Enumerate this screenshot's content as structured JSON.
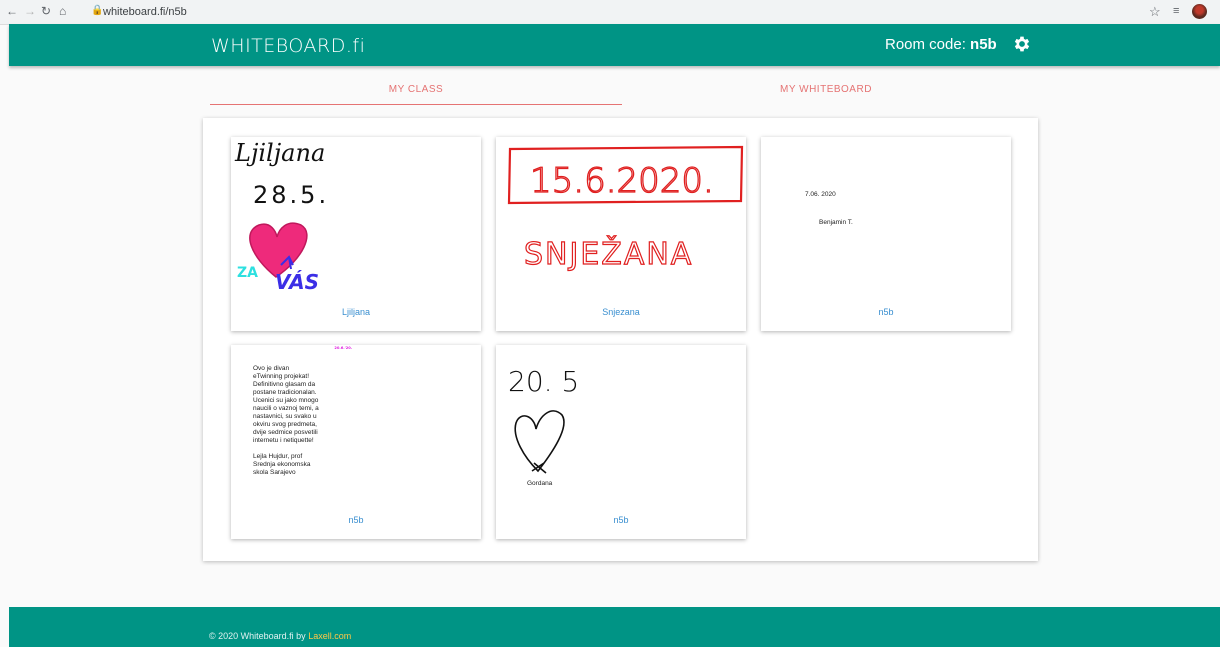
{
  "browser": {
    "url": "whiteboard.fi/n5b"
  },
  "header": {
    "logo": "WHITEBOARD.fi",
    "room_label": "Room code:",
    "room_code": "n5b"
  },
  "tabs": [
    {
      "label": "MY CLASS"
    },
    {
      "label": "MY WHITEBOARD"
    }
  ],
  "cards": [
    {
      "name": "Ljiljana",
      "drawn_name": "Ljiljana",
      "date": "28.5.",
      "za": "ZA",
      "vas": "VÁS"
    },
    {
      "name": "Snjezana",
      "date": "15.6.2020.",
      "drawn_name": "SNJEŽANA"
    },
    {
      "name": "n5b",
      "date": "7.06. 2020",
      "author": "Benjamin T."
    },
    {
      "name": "n5b",
      "date": "20.6.'20.",
      "lines": [
        "Ovo je divan",
        "eTwinning projekat!",
        "Definitivno glasam da",
        "postane tradicionalan.",
        "Ucenici su jako mnogo",
        "naucili o vaznoj temi, a",
        "nastavnici, su svako u",
        "okviru svog predmeta,",
        "dvije sedmice posvetili",
        "internetu i netiquette!",
        "",
        "Lejla Hujdur, prof",
        "Srednja ekonomska",
        "skola Sarajevo"
      ]
    },
    {
      "name": "n5b",
      "date": "20. 5",
      "author": "Gordana"
    }
  ],
  "footer": {
    "text": "© 2020 Whiteboard.fi by ",
    "link": "Laxell.com"
  },
  "colors": {
    "brand": "#009485",
    "tab_accent": "#e57373",
    "link": "#3a8fd0",
    "footer_link": "#ffc847"
  }
}
